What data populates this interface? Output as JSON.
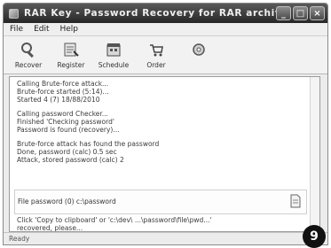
{
  "window": {
    "title": "RAR Key - Password Recovery for RAR archives",
    "minimize_glyph": "_",
    "maximize_glyph": "□",
    "close_glyph": "×"
  },
  "menu": {
    "items": [
      "File",
      "Edit",
      "Help"
    ]
  },
  "toolbar": {
    "items": [
      {
        "label": "Recover",
        "icon": "recover-icon"
      },
      {
        "label": "Register",
        "icon": "register-icon"
      },
      {
        "label": "Schedule",
        "icon": "schedule-icon"
      },
      {
        "label": "Order",
        "icon": "order-icon"
      },
      {
        "label": "",
        "icon": "settings-icon"
      }
    ]
  },
  "log": {
    "lines": [
      "Calling Brute-force attack...",
      "Brute-force started (5:14)...",
      "Started 4 (7) 18/88/2010",
      "",
      "Calling password Checker...",
      "Finished 'Checking password'",
      "Password is found (recovery)...",
      "",
      "Brute-force attack has found the password",
      "Done, password (calc) 0.5 sec",
      "Attack, stored password (calc) 2"
    ],
    "password_found": "File password (0) c:\\password",
    "tail_lines": [
      "Click 'Copy to clipboard' or 'c:\\dev\\ ...\\password\\file\\pwd...'",
      "recovered, please..."
    ]
  },
  "status": {
    "text": "Ready"
  },
  "badge": {
    "number": "9"
  }
}
